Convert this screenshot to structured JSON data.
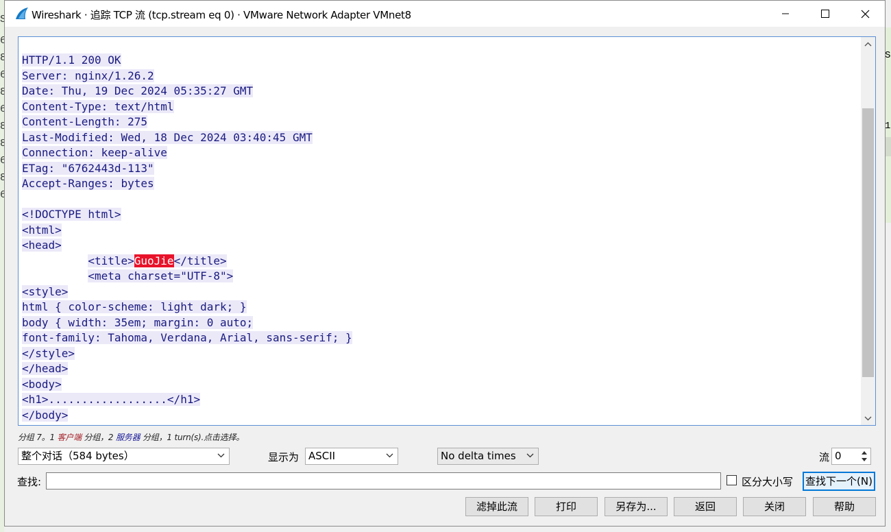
{
  "window": {
    "title": "Wireshark · 追踪 TCP 流 (tcp.stream eq 0) · VMware Network Adapter VMnet8",
    "min_icon": "minimize-icon",
    "max_icon": "maximize-icon",
    "close_icon": "close-icon"
  },
  "background": {
    "left_glyphs": [
      "S",
      "6",
      "8",
      "6",
      "8",
      "6",
      "8",
      "8",
      "6",
      "8",
      "6"
    ],
    "right_glyphs": [
      "S",
      "1"
    ]
  },
  "stream": {
    "lines": [
      {
        "text": "HTTP/1.1 200 OK"
      },
      {
        "text": "Server: nginx/1.26.2"
      },
      {
        "text": "Date: Thu, 19 Dec 2024 05:35:27 GMT"
      },
      {
        "text": "Content-Type: text/html"
      },
      {
        "text": "Content-Length: 275"
      },
      {
        "text": "Last-Modified: Wed, 18 Dec 2024 03:40:45 GMT"
      },
      {
        "text": "Connection: keep-alive"
      },
      {
        "text": "ETag: \"6762443d-113\""
      },
      {
        "text": "Accept-Ranges: bytes"
      },
      {
        "text": ""
      },
      {
        "text": "<!DOCTYPE html>"
      },
      {
        "text": "<html>"
      },
      {
        "text": "<head>"
      },
      {
        "indent": "          ",
        "before": "<title>",
        "highlight": "GuoJie",
        "after": "</title>"
      },
      {
        "indent": "          ",
        "text": "<meta charset=\"UTF-8\">"
      },
      {
        "text": "<style>"
      },
      {
        "text": "html { color-scheme: light dark; }"
      },
      {
        "text": "body { width: 35em; margin: 0 auto;"
      },
      {
        "text": "font-family: Tahoma, Verdana, Arial, sans-serif; }"
      },
      {
        "text": "</style>"
      },
      {
        "text": "</head>"
      },
      {
        "text": "<body>"
      },
      {
        "text": "<h1>..................</h1>"
      },
      {
        "text": "</body>"
      }
    ]
  },
  "summary": {
    "part1": "分组 7。1 ",
    "client": "客户端",
    "part2": " 分组，2 ",
    "server": "服务器",
    "part3": " 分组，1 turn(s).点击选择。"
  },
  "controls": {
    "conversation_select": "整个对话（584 bytes）",
    "show_as_label": "显示为",
    "show_as_value": "ASCII",
    "delta_select": "No delta times",
    "stream_label": "流",
    "stream_value": "0",
    "find_label": "查找:",
    "find_value": "",
    "case_label": "区分大小写",
    "find_next_label": "查找下一个(N)"
  },
  "buttons": {
    "filter_out": "滤掉此流",
    "print": "打印",
    "save_as": "另存为...",
    "back": "返回",
    "close": "关闭",
    "help": "帮助"
  }
}
